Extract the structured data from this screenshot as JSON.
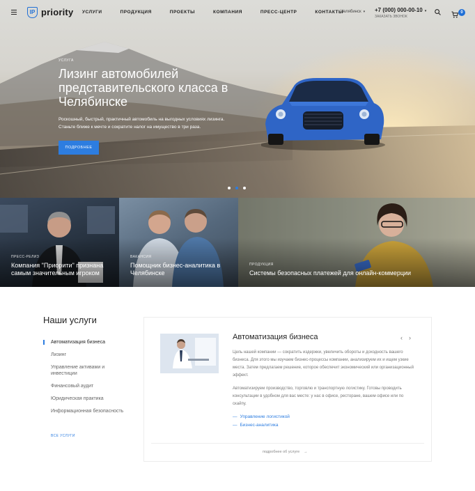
{
  "header": {
    "logo_badge": "IP",
    "logo_text": "priority",
    "nav": [
      "УСЛУГИ",
      "ПРОДУКЦИЯ",
      "ПРОЕКТЫ",
      "КОМПАНИЯ",
      "ПРЕСС-ЦЕНТР",
      "КОНТАКТЫ"
    ],
    "city": "Челябинск",
    "phone": "+7 (000) 000-00-10",
    "callback": "ЗАКАЗАТЬ ЗВОНОК",
    "cart_count": "0"
  },
  "hero": {
    "kicker": "УСЛУГА",
    "title": "Лизинг автомобилей представительского класса в Челябинске",
    "description": "Роскошный, быстрый, практичный автомобиль на выгодных условиях лизинга. Станьте ближе к мечте и сократите налог на имущество в три раза.",
    "button": "ПОДРОБНЕЕ",
    "slides": 3,
    "active_slide": 2
  },
  "tiles": [
    {
      "kicker": "ПРЕСС-РЕЛИЗ",
      "title": "Компания \"Приорити\" признана самым значительным игроком"
    },
    {
      "kicker": "ВАКАНСИЯ",
      "title": "Помощник бизнес-аналитика в Челябинске"
    },
    {
      "kicker": "ПРОДУКЦИЯ",
      "title": "Системы безопасных платежей для онлайн-коммерции"
    }
  ],
  "services": {
    "title": "Наши услуги",
    "items": [
      "Автоматизация бизнеса",
      "Лизинг",
      "Управление активами и инвестиции",
      "Финансовый аудит",
      "Юридическая практика",
      "Информационная безопасность"
    ],
    "active_index": 0,
    "all_link": "ВСЕ УСЛУГИ",
    "card": {
      "title": "Автоматизация бизнеса",
      "p1": "Цель нашей компании — сократить издержки, увеличить обороты и доходность вашего бизнеса. Для этого мы изучаем бизнес-процессы компании, анализируем их и ищем узкие места. Затем предлагаем решение, которое обеспечит экономический или организационный эффект.",
      "p2": "Автоматизируем производство, торговлю и транспортную логистику. Готовы проводить консультации в удобном для вас месте: у нас в офисе, ресторане, вашем офисе или по скайпу.",
      "links": [
        "Управление логистикой",
        "Бизнес-аналитика"
      ],
      "more": "подробнее об услуге"
    }
  },
  "colors": {
    "accent": "#2d7de0",
    "brand": "#1f6fd6"
  }
}
